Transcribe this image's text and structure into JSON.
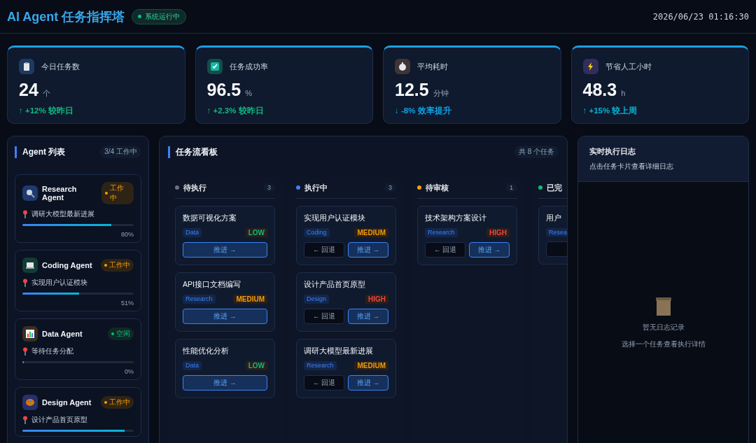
{
  "header": {
    "title": "AI Agent 任务指挥塔",
    "status": "系统运行中",
    "datetime": "2026/06/23 01:16:30"
  },
  "stats": [
    {
      "kind": "clipboard",
      "label": "今日任务数",
      "value": "24",
      "unit": "个",
      "trend": {
        "text": "↑ +12% 较昨日",
        "color": "#10b981"
      }
    },
    {
      "kind": "check",
      "label": "任务成功率",
      "value": "96.5",
      "unit": "%",
      "trend": {
        "text": "↑ +2.3% 较昨日",
        "color": "#10b981"
      }
    },
    {
      "kind": "timer",
      "label": "平均耗时",
      "value": "12.5",
      "unit": "分钟",
      "trend": {
        "text": "↓ -8% 效率提升",
        "color": "#0ea5e9"
      }
    },
    {
      "kind": "bolt",
      "label": "节省人工小时",
      "value": "48.3",
      "unit": "h",
      "trend": {
        "text": "↑ +15% 较上周",
        "color": "#06b6d4"
      }
    }
  ],
  "agents_panel": {
    "title": "Agent 列表",
    "count": "3/4 工作中"
  },
  "agents": [
    {
      "kind": "search",
      "name": "Research Agent",
      "status": {
        "kind": "working",
        "label": "工作中"
      },
      "task": "调研大模型最新进展",
      "level": 0.8,
      "percent": "80%"
    },
    {
      "kind": "laptop",
      "name": "Coding Agent",
      "status": {
        "kind": "working",
        "label": "工作中"
      },
      "task": "实现用户认证模块",
      "level": 0.51,
      "percent": "51%"
    },
    {
      "kind": "chart",
      "name": "Data Agent",
      "status": {
        "kind": "idle",
        "label": "空闲"
      },
      "task": "等待任务分配",
      "level": 0,
      "percent": "0%"
    },
    {
      "kind": "palette",
      "name": "Design Agent",
      "status": {
        "kind": "working",
        "label": "工作中"
      },
      "task": "设计产品首页原型",
      "level": 0.92
    }
  ],
  "board": {
    "title": "任务流看板",
    "count": "共 8 个任务"
  },
  "columns": [
    {
      "title": "待执行",
      "color": "#6b7280",
      "count": "3",
      "tasks": [
        {
          "title": "数据可视化方案",
          "tag": "Data",
          "priority": {
            "label": "LOW",
            "color": "#10b981"
          },
          "actions": [
            {
              "kind": "forward",
              "label": "推进 →"
            }
          ]
        },
        {
          "title": "API接口文档编写",
          "tag": "Research",
          "priority": {
            "label": "MEDIUM",
            "color": "#f59e0b"
          },
          "actions": [
            {
              "kind": "forward",
              "label": "推进 →"
            }
          ]
        },
        {
          "title": "性能优化分析",
          "tag": "Data",
          "priority": {
            "label": "LOW",
            "color": "#10b981"
          },
          "actions": [
            {
              "kind": "forward",
              "label": "推进 →"
            }
          ]
        }
      ]
    },
    {
      "title": "执行中",
      "color": "#3b82f6",
      "count": "3",
      "tasks": [
        {
          "title": "实现用户认证模块",
          "tag": "Coding",
          "priority": {
            "label": "MEDIUM",
            "color": "#f59e0b"
          },
          "actions": [
            {
              "kind": "back",
              "label": "← 回退"
            },
            {
              "kind": "forward",
              "label": "推进 →"
            }
          ]
        },
        {
          "title": "设计产品首页原型",
          "tag": "Design",
          "priority": {
            "label": "HIGH",
            "color": "#ef4444"
          },
          "actions": [
            {
              "kind": "back",
              "label": "← 回退"
            },
            {
              "kind": "forward",
              "label": "推进 →"
            }
          ]
        },
        {
          "title": "调研大模型最新进展",
          "tag": "Research",
          "priority": {
            "label": "MEDIUM",
            "color": "#f59e0b"
          },
          "actions": [
            {
              "kind": "back",
              "label": "← 回退"
            },
            {
              "kind": "forward",
              "label": "推进 →"
            }
          ]
        }
      ]
    },
    {
      "title": "待审核",
      "color": "#f59e0b",
      "count": "1",
      "tasks": [
        {
          "title": "技术架构方案设计",
          "tag": "Research",
          "priority": {
            "label": "HIGH",
            "color": "#ef4444"
          },
          "actions": [
            {
              "kind": "back",
              "label": "← 回退"
            },
            {
              "kind": "forward",
              "label": "推进 →"
            }
          ]
        }
      ]
    },
    {
      "title": "已完",
      "color": "#10b981",
      "tasks": [
        {
          "title": "用户",
          "tag": "Resea",
          "actions": [
            {
              "kind": "back"
            }
          ]
        }
      ]
    }
  ],
  "log": {
    "title": "实时执行日志",
    "subtitle": "点击任务卡片查看详细日志",
    "empty_title": "暂无日志记录",
    "empty_hint": "选择一个任务查看执行详情"
  }
}
